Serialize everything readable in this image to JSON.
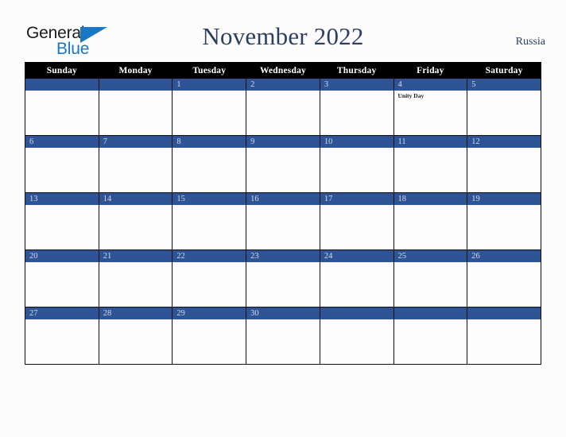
{
  "brand": {
    "name_top": "General",
    "name_bottom": "Blue",
    "triangle_color": "#1878c4",
    "top_color": "#1b1b1b"
  },
  "header": {
    "title": "November 2022",
    "country": "Russia",
    "title_color": "#2c3e62"
  },
  "calendar": {
    "weekday_headers": [
      "Sunday",
      "Monday",
      "Tuesday",
      "Wednesday",
      "Thursday",
      "Friday",
      "Saturday"
    ],
    "header_bg": "#000000",
    "daybar_bg": "#2f5496",
    "daynum_color": "#d3dbe6",
    "cell_bg": "#fdfdfd",
    "weeks": [
      [
        {
          "day": "",
          "events": []
        },
        {
          "day": "",
          "events": []
        },
        {
          "day": "1",
          "events": []
        },
        {
          "day": "2",
          "events": []
        },
        {
          "day": "3",
          "events": []
        },
        {
          "day": "4",
          "events": [
            "Unity Day"
          ]
        },
        {
          "day": "5",
          "events": []
        }
      ],
      [
        {
          "day": "6",
          "events": []
        },
        {
          "day": "7",
          "events": []
        },
        {
          "day": "8",
          "events": []
        },
        {
          "day": "9",
          "events": []
        },
        {
          "day": "10",
          "events": []
        },
        {
          "day": "11",
          "events": []
        },
        {
          "day": "12",
          "events": []
        }
      ],
      [
        {
          "day": "13",
          "events": []
        },
        {
          "day": "14",
          "events": []
        },
        {
          "day": "15",
          "events": []
        },
        {
          "day": "16",
          "events": []
        },
        {
          "day": "17",
          "events": []
        },
        {
          "day": "18",
          "events": []
        },
        {
          "day": "19",
          "events": []
        }
      ],
      [
        {
          "day": "20",
          "events": []
        },
        {
          "day": "21",
          "events": []
        },
        {
          "day": "22",
          "events": []
        },
        {
          "day": "23",
          "events": []
        },
        {
          "day": "24",
          "events": []
        },
        {
          "day": "25",
          "events": []
        },
        {
          "day": "26",
          "events": []
        }
      ],
      [
        {
          "day": "27",
          "events": []
        },
        {
          "day": "28",
          "events": []
        },
        {
          "day": "29",
          "events": []
        },
        {
          "day": "30",
          "events": []
        },
        {
          "day": "",
          "events": []
        },
        {
          "day": "",
          "events": []
        },
        {
          "day": "",
          "events": []
        }
      ]
    ]
  }
}
